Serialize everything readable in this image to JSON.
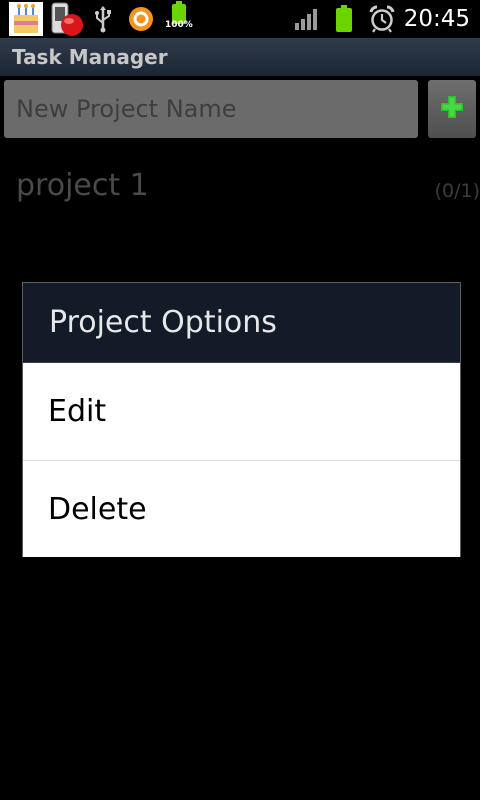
{
  "status_bar": {
    "icons": [
      "app-notification-icon",
      "phone-notification-icon",
      "usb-icon",
      "orange-circle-icon",
      "battery-full-icon",
      "signal-icon",
      "battery-icon",
      "alarm-icon"
    ],
    "battery_percent": "100%",
    "time": "20:45"
  },
  "title_bar": {
    "title": "Task Manager"
  },
  "new_project": {
    "placeholder": "New Project Name",
    "add_icon": "plus-icon"
  },
  "projects": [
    {
      "name": "project 1",
      "count": "(0/1)"
    }
  ],
  "dialog": {
    "title": "Project Options",
    "items": [
      {
        "label": "Edit"
      },
      {
        "label": "Delete"
      }
    ]
  },
  "colors": {
    "title_bar": "#1c2533",
    "dialog_header": "#141b28",
    "add_plus": "#2fbf2f",
    "battery": "#6cd400",
    "orange_circle": "#f7941d"
  }
}
